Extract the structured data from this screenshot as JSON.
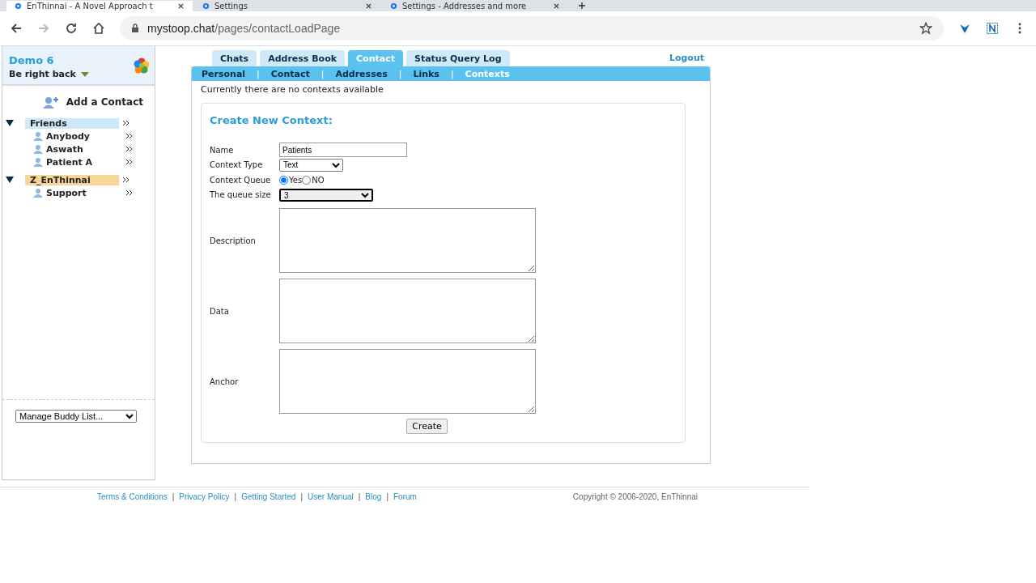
{
  "browser": {
    "tabs": [
      {
        "title": "EnThinnai - A Novel Approach t",
        "selected": true
      },
      {
        "title": "Settings",
        "selected": false
      },
      {
        "title": "Settings - Addresses and more",
        "selected": false
      }
    ],
    "url_host": "mystoop.chat",
    "url_path": "/pages/contactLoadPage"
  },
  "sidebar": {
    "user_name": "Demo 6",
    "status": "Be right back",
    "add_contact": "Add a Contact",
    "groups": [
      {
        "name": "Friends",
        "color": "#cde9f7",
        "expanded": true,
        "children": [
          {
            "name": "Anybody"
          },
          {
            "name": "Aswath"
          },
          {
            "name": "Patient A"
          }
        ]
      },
      {
        "name": "Z_EnThinnai",
        "color": "#f8d59b",
        "expanded": true,
        "children": [
          {
            "name": "Support"
          }
        ]
      }
    ],
    "manage_select": "Manage Buddy List..."
  },
  "nav": {
    "tabs": [
      {
        "label": "Chats",
        "selected": false
      },
      {
        "label": "Address Book",
        "selected": false
      },
      {
        "label": "Contact",
        "selected": true
      },
      {
        "label": "Status Query Log",
        "selected": false
      }
    ],
    "logout": "Logout",
    "subtabs": [
      {
        "label": "Personal",
        "selected": false
      },
      {
        "label": "Contact",
        "selected": false
      },
      {
        "label": "Addresses",
        "selected": false
      },
      {
        "label": "Links",
        "selected": false
      },
      {
        "label": "Contexts",
        "selected": true
      }
    ],
    "separators": [
      "|",
      "|",
      "|",
      "|"
    ]
  },
  "message": "Currently there are no contexts available",
  "form": {
    "title": "Create New Context:",
    "name_label": "Name",
    "name_value": "Patients",
    "type_label": "Context Type",
    "type_value": "Text",
    "queue_label": "Context Queue",
    "queue_options": [
      {
        "label": "Yes",
        "selected": true
      },
      {
        "label": "NO",
        "selected": false
      }
    ],
    "size_label": "The queue size",
    "size_value": "3",
    "areas": [
      {
        "label": "Description"
      },
      {
        "label": "Data"
      },
      {
        "label": "Anchor"
      }
    ],
    "create": "Create"
  },
  "footer": {
    "links": [
      "Terms & Conditions",
      "Privacy Policy",
      "Getting Started",
      "User Manual",
      "Blog",
      "Forum"
    ],
    "separators": [
      "|",
      "|",
      "|",
      "|",
      "|"
    ],
    "copyright": "Copyright © 2006-2020, EnThinnai"
  }
}
